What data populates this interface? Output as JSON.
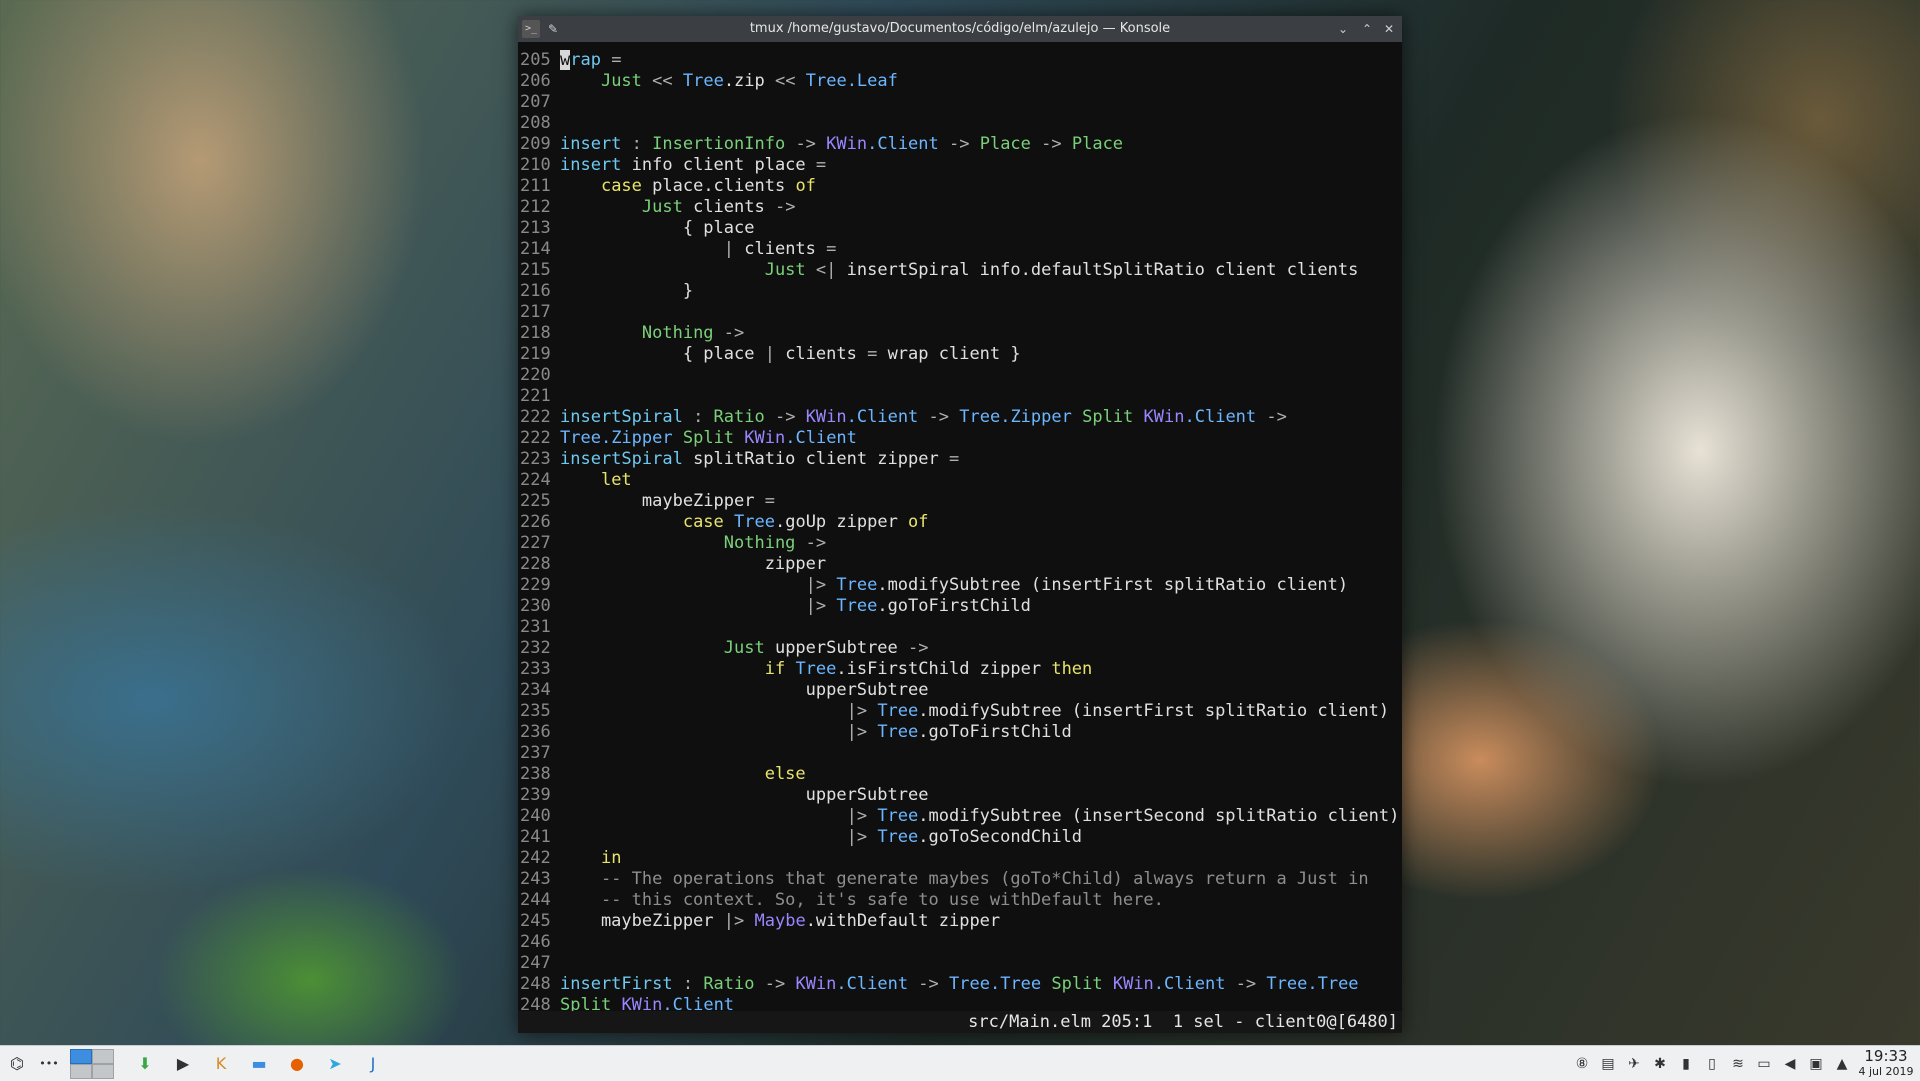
{
  "window": {
    "title": "tmux /home/gustavo/Documentos/código/elm/azulejo — Konsole",
    "controls": {
      "minimize": "⌄",
      "maximize": "⌃",
      "close": "✕"
    }
  },
  "editor": {
    "lines": [
      {
        "n": "205",
        "tokens": [
          {
            "t": "w",
            "c": "cursor"
          },
          {
            "t": "rap ",
            "c": "tk-fn"
          },
          {
            "t": "=",
            "c": "tk-op"
          }
        ]
      },
      {
        "n": "206",
        "tokens": [
          {
            "t": "    "
          },
          {
            "t": "Just",
            "c": "tk-ty"
          },
          {
            "t": " << ",
            "c": "tk-op"
          },
          {
            "t": "Tree",
            "c": "tk-mod"
          },
          {
            "t": ".zip "
          },
          {
            "t": "<<",
            "c": "tk-op"
          },
          {
            "t": " "
          },
          {
            "t": "Tree",
            "c": "tk-mod"
          },
          {
            "t": ".Leaf",
            "c": "tk-mod"
          }
        ]
      },
      {
        "n": "207",
        "tokens": []
      },
      {
        "n": "208",
        "tokens": []
      },
      {
        "n": "209",
        "tokens": [
          {
            "t": "insert",
            "c": "tk-fn"
          },
          {
            "t": " : ",
            "c": "tk-op"
          },
          {
            "t": "InsertionInfo",
            "c": "tk-ty"
          },
          {
            "t": " -> ",
            "c": "tk-op"
          },
          {
            "t": "KWin",
            "c": "tk-nm"
          },
          {
            "t": ".Client",
            "c": "tk-mod"
          },
          {
            "t": " -> ",
            "c": "tk-op"
          },
          {
            "t": "Place",
            "c": "tk-ty"
          },
          {
            "t": " -> ",
            "c": "tk-op"
          },
          {
            "t": "Place",
            "c": "tk-ty"
          }
        ]
      },
      {
        "n": "210",
        "tokens": [
          {
            "t": "insert",
            "c": "tk-fn"
          },
          {
            "t": " info client place "
          },
          {
            "t": "=",
            "c": "tk-op"
          }
        ]
      },
      {
        "n": "211",
        "tokens": [
          {
            "t": "    "
          },
          {
            "t": "case",
            "c": "tk-kw"
          },
          {
            "t": " place.clients "
          },
          {
            "t": "of",
            "c": "tk-kw"
          }
        ]
      },
      {
        "n": "212",
        "tokens": [
          {
            "t": "        "
          },
          {
            "t": "Just",
            "c": "tk-ty"
          },
          {
            "t": " clients "
          },
          {
            "t": "->",
            "c": "tk-op"
          }
        ]
      },
      {
        "n": "213",
        "tokens": [
          {
            "t": "            { place"
          }
        ]
      },
      {
        "n": "214",
        "tokens": [
          {
            "t": "                "
          },
          {
            "t": "|",
            "c": "tk-op"
          },
          {
            "t": " clients "
          },
          {
            "t": "=",
            "c": "tk-op"
          }
        ]
      },
      {
        "n": "215",
        "tokens": [
          {
            "t": "                    "
          },
          {
            "t": "Just",
            "c": "tk-ty"
          },
          {
            "t": " <| ",
            "c": "tk-op"
          },
          {
            "t": "insertSpiral info.defaultSplitRatio client clients"
          }
        ]
      },
      {
        "n": "216",
        "tokens": [
          {
            "t": "            }"
          }
        ]
      },
      {
        "n": "217",
        "tokens": []
      },
      {
        "n": "218",
        "tokens": [
          {
            "t": "        "
          },
          {
            "t": "Nothing",
            "c": "tk-ty"
          },
          {
            "t": " ->",
            "c": "tk-op"
          }
        ]
      },
      {
        "n": "219",
        "tokens": [
          {
            "t": "            { place "
          },
          {
            "t": "|",
            "c": "tk-op"
          },
          {
            "t": " clients "
          },
          {
            "t": "=",
            "c": "tk-op"
          },
          {
            "t": " wrap client }"
          }
        ]
      },
      {
        "n": "220",
        "tokens": []
      },
      {
        "n": "221",
        "tokens": []
      },
      {
        "n": "222",
        "tokens": [
          {
            "t": "insertSpiral",
            "c": "tk-fn"
          },
          {
            "t": " : ",
            "c": "tk-op"
          },
          {
            "t": "Ratio",
            "c": "tk-ty"
          },
          {
            "t": " -> ",
            "c": "tk-op"
          },
          {
            "t": "KWin",
            "c": "tk-nm"
          },
          {
            "t": ".Client",
            "c": "tk-mod"
          },
          {
            "t": " -> ",
            "c": "tk-op"
          },
          {
            "t": "Tree",
            "c": "tk-mod"
          },
          {
            "t": ".Zipper",
            "c": "tk-mod"
          },
          {
            "t": " "
          },
          {
            "t": "Split",
            "c": "tk-ty"
          },
          {
            "t": " "
          },
          {
            "t": "KWin",
            "c": "tk-nm"
          },
          {
            "t": ".Client",
            "c": "tk-mod"
          },
          {
            "t": " ->",
            "c": "tk-op"
          }
        ]
      },
      {
        "n": "222",
        "tokens": [
          {
            "t": "Tree",
            "c": "tk-mod"
          },
          {
            "t": ".Zipper",
            "c": "tk-mod"
          },
          {
            "t": " "
          },
          {
            "t": "Split",
            "c": "tk-ty"
          },
          {
            "t": " "
          },
          {
            "t": "KWin",
            "c": "tk-nm"
          },
          {
            "t": ".Client",
            "c": "tk-mod"
          }
        ]
      },
      {
        "n": "223",
        "tokens": [
          {
            "t": "insertSpiral",
            "c": "tk-fn"
          },
          {
            "t": " splitRatio client zipper "
          },
          {
            "t": "=",
            "c": "tk-op"
          }
        ]
      },
      {
        "n": "224",
        "tokens": [
          {
            "t": "    "
          },
          {
            "t": "let",
            "c": "tk-kw"
          }
        ]
      },
      {
        "n": "225",
        "tokens": [
          {
            "t": "        maybeZipper "
          },
          {
            "t": "=",
            "c": "tk-op"
          }
        ]
      },
      {
        "n": "226",
        "tokens": [
          {
            "t": "            "
          },
          {
            "t": "case",
            "c": "tk-kw"
          },
          {
            "t": " "
          },
          {
            "t": "Tree",
            "c": "tk-mod"
          },
          {
            "t": ".goUp zipper "
          },
          {
            "t": "of",
            "c": "tk-kw"
          }
        ]
      },
      {
        "n": "227",
        "tokens": [
          {
            "t": "                "
          },
          {
            "t": "Nothing",
            "c": "tk-ty"
          },
          {
            "t": " ->",
            "c": "tk-op"
          }
        ]
      },
      {
        "n": "228",
        "tokens": [
          {
            "t": "                    zipper"
          }
        ]
      },
      {
        "n": "229",
        "tokens": [
          {
            "t": "                        "
          },
          {
            "t": "|>",
            "c": "tk-op"
          },
          {
            "t": " "
          },
          {
            "t": "Tree",
            "c": "tk-mod"
          },
          {
            "t": ".modifySubtree (insertFirst splitRatio client)"
          }
        ]
      },
      {
        "n": "230",
        "tokens": [
          {
            "t": "                        "
          },
          {
            "t": "|>",
            "c": "tk-op"
          },
          {
            "t": " "
          },
          {
            "t": "Tree",
            "c": "tk-mod"
          },
          {
            "t": ".goToFirstChild"
          }
        ]
      },
      {
        "n": "231",
        "tokens": []
      },
      {
        "n": "232",
        "tokens": [
          {
            "t": "                "
          },
          {
            "t": "Just",
            "c": "tk-ty"
          },
          {
            "t": " upperSubtree "
          },
          {
            "t": "->",
            "c": "tk-op"
          }
        ]
      },
      {
        "n": "233",
        "tokens": [
          {
            "t": "                    "
          },
          {
            "t": "if",
            "c": "tk-kw"
          },
          {
            "t": " "
          },
          {
            "t": "Tree",
            "c": "tk-mod"
          },
          {
            "t": ".isFirstChild zipper "
          },
          {
            "t": "then",
            "c": "tk-kw"
          }
        ]
      },
      {
        "n": "234",
        "tokens": [
          {
            "t": "                        upperSubtree"
          }
        ]
      },
      {
        "n": "235",
        "tokens": [
          {
            "t": "                            "
          },
          {
            "t": "|>",
            "c": "tk-op"
          },
          {
            "t": " "
          },
          {
            "t": "Tree",
            "c": "tk-mod"
          },
          {
            "t": ".modifySubtree (insertFirst splitRatio client)"
          }
        ]
      },
      {
        "n": "236",
        "tokens": [
          {
            "t": "                            "
          },
          {
            "t": "|>",
            "c": "tk-op"
          },
          {
            "t": " "
          },
          {
            "t": "Tree",
            "c": "tk-mod"
          },
          {
            "t": ".goToFirstChild"
          }
        ]
      },
      {
        "n": "237",
        "tokens": []
      },
      {
        "n": "238",
        "tokens": [
          {
            "t": "                    "
          },
          {
            "t": "else",
            "c": "tk-kw"
          }
        ]
      },
      {
        "n": "239",
        "tokens": [
          {
            "t": "                        upperSubtree"
          }
        ]
      },
      {
        "n": "240",
        "tokens": [
          {
            "t": "                            "
          },
          {
            "t": "|>",
            "c": "tk-op"
          },
          {
            "t": " "
          },
          {
            "t": "Tree",
            "c": "tk-mod"
          },
          {
            "t": ".modifySubtree (insertSecond splitRatio client)"
          }
        ]
      },
      {
        "n": "241",
        "tokens": [
          {
            "t": "                            "
          },
          {
            "t": "|>",
            "c": "tk-op"
          },
          {
            "t": " "
          },
          {
            "t": "Tree",
            "c": "tk-mod"
          },
          {
            "t": ".goToSecondChild"
          }
        ]
      },
      {
        "n": "242",
        "tokens": [
          {
            "t": "    "
          },
          {
            "t": "in",
            "c": "tk-kw"
          }
        ]
      },
      {
        "n": "243",
        "tokens": [
          {
            "t": "    -- The operations that generate maybes (goTo*Child) always return a Just in",
            "c": "tk-cm"
          }
        ]
      },
      {
        "n": "244",
        "tokens": [
          {
            "t": "    -- this context. So, it's safe to use withDefault here.",
            "c": "tk-cm"
          }
        ]
      },
      {
        "n": "245",
        "tokens": [
          {
            "t": "    maybeZipper "
          },
          {
            "t": "|>",
            "c": "tk-op"
          },
          {
            "t": " "
          },
          {
            "t": "Maybe",
            "c": "tk-nm"
          },
          {
            "t": ".withDefault zipper"
          }
        ]
      },
      {
        "n": "246",
        "tokens": []
      },
      {
        "n": "247",
        "tokens": []
      },
      {
        "n": "248",
        "tokens": [
          {
            "t": "insertFirst",
            "c": "tk-fn"
          },
          {
            "t": " : ",
            "c": "tk-op"
          },
          {
            "t": "Ratio",
            "c": "tk-ty"
          },
          {
            "t": " -> ",
            "c": "tk-op"
          },
          {
            "t": "KWin",
            "c": "tk-nm"
          },
          {
            "t": ".Client",
            "c": "tk-mod"
          },
          {
            "t": " -> ",
            "c": "tk-op"
          },
          {
            "t": "Tree",
            "c": "tk-mod"
          },
          {
            "t": ".Tree",
            "c": "tk-mod"
          },
          {
            "t": " "
          },
          {
            "t": "Split",
            "c": "tk-ty"
          },
          {
            "t": " "
          },
          {
            "t": "KWin",
            "c": "tk-nm"
          },
          {
            "t": ".Client",
            "c": "tk-mod"
          },
          {
            "t": " -> ",
            "c": "tk-op"
          },
          {
            "t": "Tree",
            "c": "tk-mod"
          },
          {
            "t": ".Tree",
            "c": "tk-mod"
          }
        ]
      },
      {
        "n": "248",
        "tokens": [
          {
            "t": "Split",
            "c": "tk-ty"
          },
          {
            "t": " "
          },
          {
            "t": "KWin",
            "c": "tk-nm"
          },
          {
            "t": ".Client",
            "c": "tk-mod"
          }
        ]
      }
    ],
    "status": "src/Main.elm 205:1  1 sel - client0@[6480]"
  },
  "taskbar": {
    "launcher_icon": "⌬",
    "more_icon": "•••",
    "apps": [
      {
        "name": "downloads-app-icon",
        "glyph": "⬇",
        "color": "#3aa745"
      },
      {
        "name": "terminal-app-icon",
        "glyph": "▶",
        "color": "#2f3337"
      },
      {
        "name": "kakoune-app-icon",
        "glyph": "K",
        "color": "#d88a28"
      },
      {
        "name": "file-manager-app-icon",
        "glyph": "▬",
        "color": "#3d8ee0"
      },
      {
        "name": "firefox-app-icon",
        "glyph": "●",
        "color": "#e66000"
      },
      {
        "name": "telegram-app-icon",
        "glyph": "➤",
        "color": "#2ea6e0"
      },
      {
        "name": "joplin-app-icon",
        "glyph": "J",
        "color": "#1f73c8"
      }
    ],
    "tray": [
      "⑧",
      "▤",
      "✈",
      "✱",
      "▮",
      "▯",
      "≋",
      "▭",
      "◀",
      "▣",
      "▲"
    ],
    "clock": {
      "time": "19:33",
      "date": "4 jul 2019"
    }
  }
}
